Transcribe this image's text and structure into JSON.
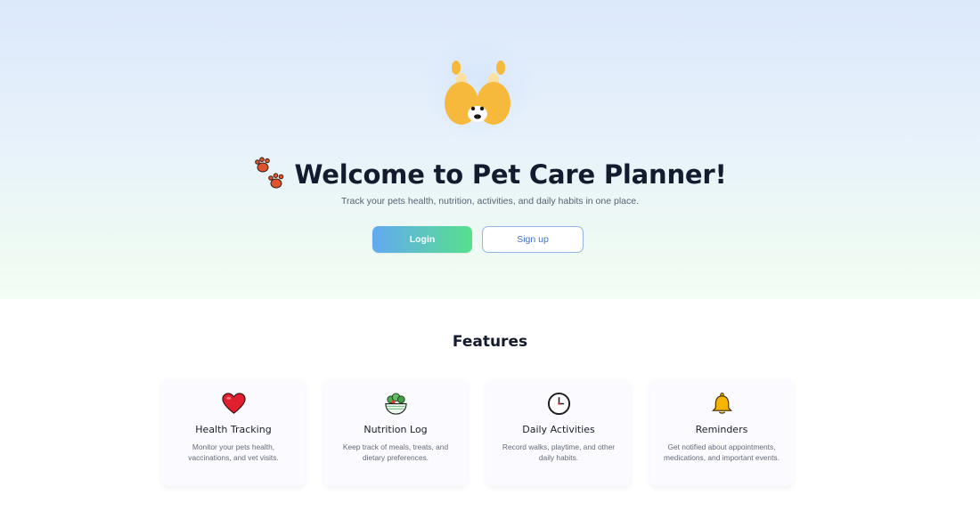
{
  "hero": {
    "logo_icon": "dog-face-icon",
    "paw_icon": "paw-prints-icon",
    "title": "Welcome to Pet Care Planner!",
    "subtitle": "Track your pets health, nutrition, activities, and daily habits in one place.",
    "login_label": "Login",
    "signup_label": "Sign up"
  },
  "features": {
    "heading": "Features",
    "cards": [
      {
        "icon": "heart-icon",
        "title": "Health Tracking",
        "description": "Monitor your pets health, vaccinations, and vet visits."
      },
      {
        "icon": "salad-bowl-icon",
        "title": "Nutrition Log",
        "description": "Keep track of meals, treats, and dietary preferences."
      },
      {
        "icon": "clock-icon",
        "title": "Daily Activities",
        "description": "Record walks, playtime, and other daily habits."
      },
      {
        "icon": "bell-icon",
        "title": "Reminders",
        "description": "Get notified about appointments, medications, and important events."
      }
    ]
  },
  "colors": {
    "title_text": "#141b2e",
    "login_gradient_start": "#63a9f2",
    "login_gradient_end": "#57e08c",
    "signup_border": "#92b6e8",
    "signup_text": "#3f72c2"
  }
}
